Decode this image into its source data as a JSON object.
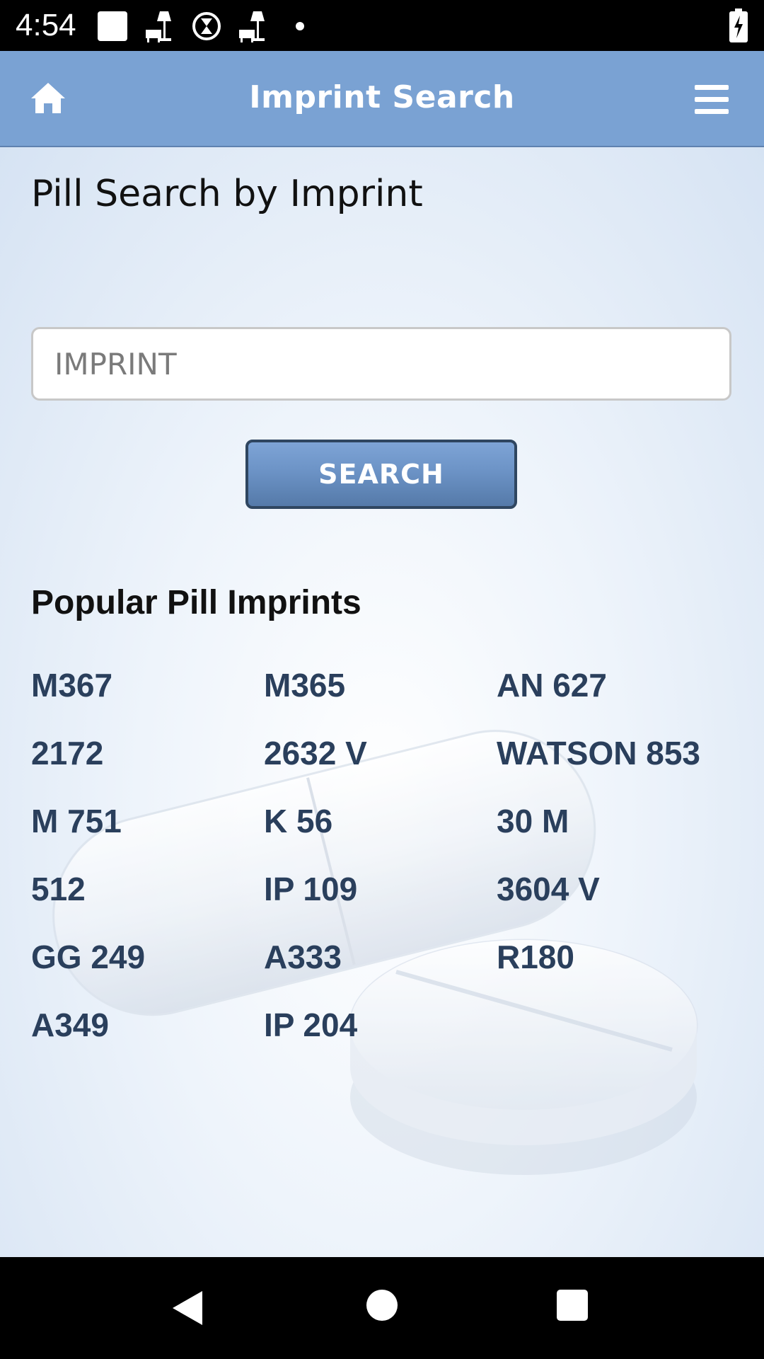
{
  "status_bar": {
    "time": "4:54"
  },
  "app_bar": {
    "title": "Imprint Search",
    "home_icon": "home-icon",
    "menu_icon": "hamburger-menu-icon",
    "background_color": "#7aa2d3"
  },
  "page": {
    "heading": "Pill Search by Imprint",
    "search_input": {
      "placeholder": "IMPRINT",
      "value": ""
    },
    "search_button_label": "SEARCH",
    "popular_heading": "Popular Pill Imprints",
    "popular_imprints": [
      "M367",
      "M365",
      "AN 627",
      "2172",
      "2632 V",
      "WATSON 853",
      "M 751",
      "K 56",
      "30 M",
      "512",
      "IP 109",
      "3604 V",
      "GG 249",
      "A333",
      "R180",
      "A349",
      "IP 204"
    ]
  },
  "nav_bar": {
    "back_icon": "back-triangle-icon",
    "home_icon": "home-circle-icon",
    "recents_icon": "recents-square-icon"
  }
}
